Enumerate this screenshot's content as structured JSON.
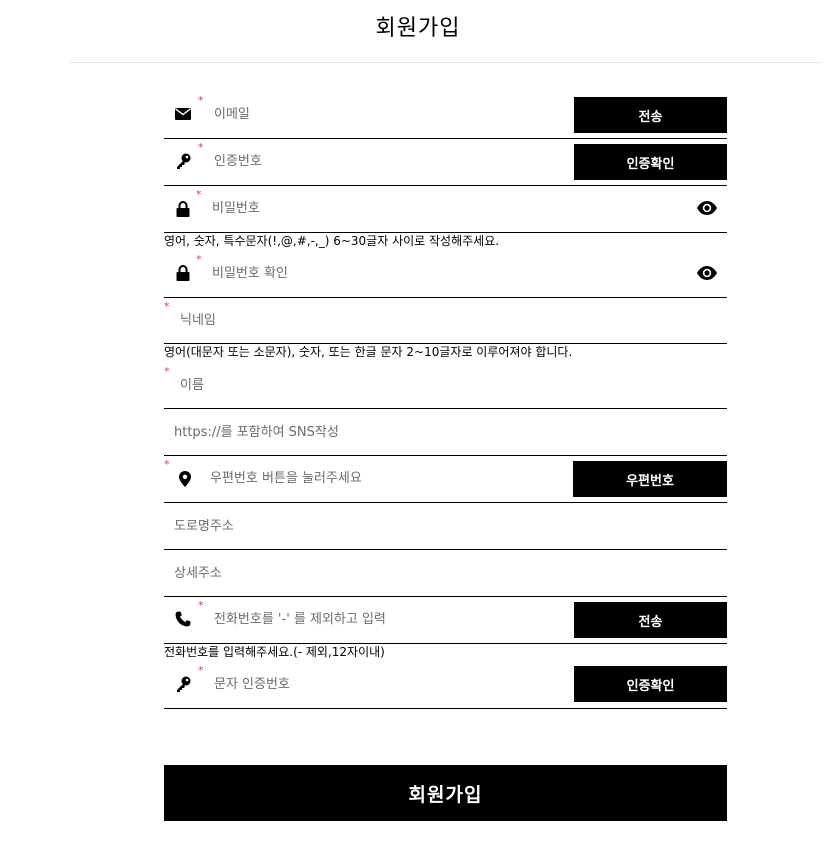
{
  "header": {
    "title": "회원가입"
  },
  "form": {
    "email": {
      "placeholder": "이메일",
      "button": "전송",
      "required": "*",
      "icon": "envelope-icon"
    },
    "auth_code": {
      "placeholder": "인증번호",
      "button": "인증확인",
      "required": "*",
      "icon": "key-icon"
    },
    "password": {
      "placeholder": "비밀번호",
      "required": "*",
      "icon": "lock-icon",
      "toggle_icon": "eye-icon",
      "hint": "영어, 숫자, 특수문자(!,@,#,-,_) 6~30글자 사이로 작성해주세요."
    },
    "password_confirm": {
      "placeholder": "비밀번호 확인",
      "required": "*",
      "icon": "lock-icon",
      "toggle_icon": "eye-icon"
    },
    "nickname": {
      "placeholder": "닉네임",
      "required": "*",
      "hint": "영어(대문자 또는 소문자), 숫자, 또는 한글 문자 2~10글자로 이루어져야 합니다."
    },
    "name": {
      "placeholder": "이름",
      "required": "*"
    },
    "sns": {
      "placeholder": "https://를 포함하여 SNS작성"
    },
    "zipcode": {
      "placeholder": "우편번호 버튼을 눌러주세요",
      "button": "우편번호",
      "required": "*",
      "icon": "map-pin-icon"
    },
    "road_address": {
      "placeholder": "도로명주소"
    },
    "detail_address": {
      "placeholder": "상세주소"
    },
    "phone": {
      "placeholder": "전화번호를 '-' 를 제외하고 입력",
      "button": "전송",
      "required": "*",
      "icon": "phone-icon",
      "hint": "전화번호를 입력해주세요.(- 제외,12자이내)"
    },
    "sms_code": {
      "placeholder": "문자 인증번호",
      "button": "인증확인",
      "required": "*",
      "icon": "key-icon"
    },
    "submit_label": "회원가입"
  }
}
